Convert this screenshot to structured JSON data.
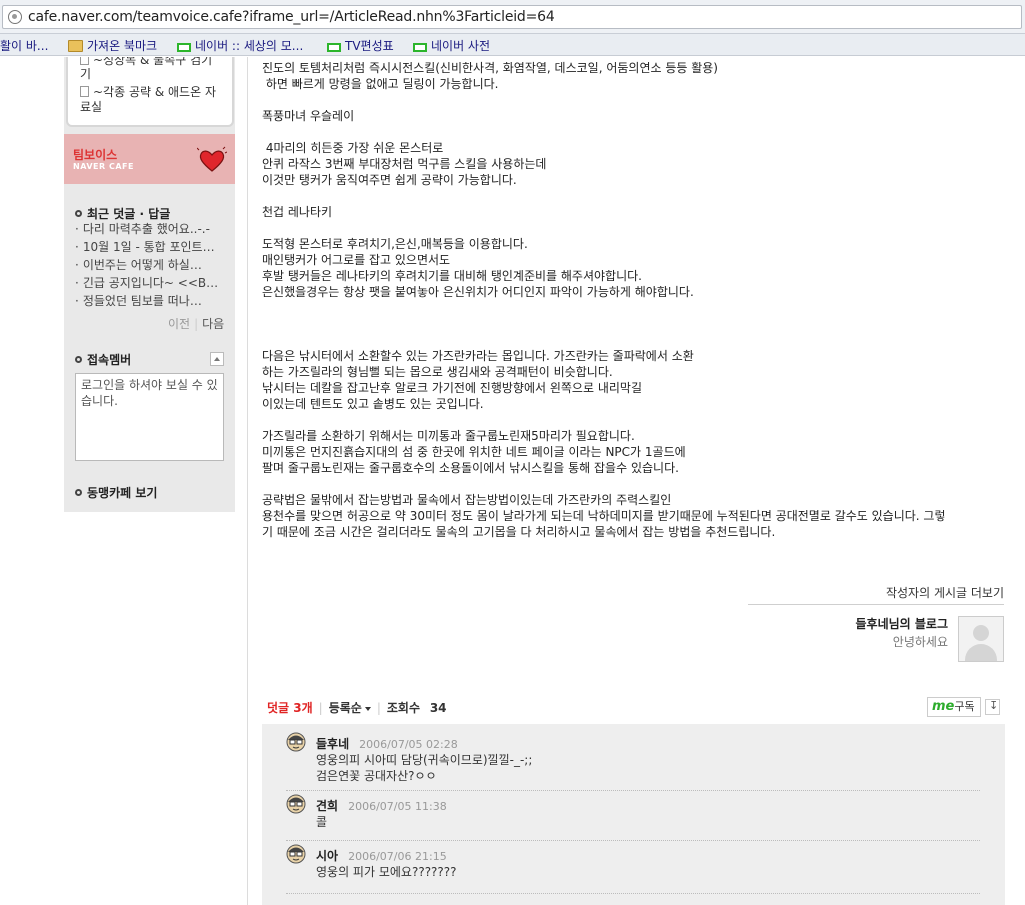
{
  "browser": {
    "url": "cafe.naver.com/teamvoice.cafe?iframe_url=/ArticleRead.nhn%3Farticleid=64",
    "bookmarks": [
      "활이 바...",
      "가져온 북마크",
      "네이버 :: 세상의 모...",
      "TV편성표",
      "네이버 사전"
    ]
  },
  "sidebar": {
    "menu_partial": "~성장목 & 물속구 검기",
    "menu_partial_2": "기",
    "menu_item": "~각종 공략 & 애드온 자",
    "menu_item_2": "료실",
    "banner_title": "팀보이스",
    "banner_sub": "NAVER CAFE",
    "recent_comments_title": "최근 덧글 · 답글",
    "recent_comments": [
      "다리 마력추출 했어요..-.-",
      "10월 1일 - 통합 포인트…",
      "이번주는 어떻게 하실…",
      "긴급 공지입니다~ <<B…",
      "정들었던 팀보를 떠나…"
    ],
    "prev": "이전",
    "next": "다음",
    "online_title": "접속멤버",
    "login_msg": "로그인을 하셔야 보실 수 있습니다.",
    "allied_title": "동맹카페 보기"
  },
  "article": {
    "lines": [
      "진도의 토템처리처럼 즉시시전스킬(신비한사격, 화염작열, 데스코일, 어둠의연소 등등 활용)",
      " 하면 빠르게 망령을 없애고 딜링이 가능합니다.",
      "",
      "폭풍마녀 우슬레이",
      "",
      " 4마리의 히든중 가장 쉬운 몬스터로",
      "안퀴 라작스 3번째 부대장처럼 먹구름 스킬을 사용하는데",
      "이것만 탱커가 움직여주면 쉽게 공략이 가능합니다.",
      "",
      "천겁 레나타키",
      "",
      "도적형 몬스터로 후려치기,은신,매복등을 이용합니다.",
      "매인탱커가 어그로를 잡고 있으면서도",
      "후발 탱커들은 레나타키의 후려치기를 대비해 탱인계준비를 해주셔야합니다.",
      "은신했을경우는 항상 팻을 붙여놓아 은신위치가 어디인지 파악이 가능하게 해야합니다.",
      "",
      "",
      "",
      "다음은 낚시터에서 소환할수 있는 가즈란카라는 몹입니다. 가즈란카는 줄파락에서 소환",
      "하는 가즈릴라의 형님뻘 되는 몹으로 생김새와 공격패턴이 비슷합니다.",
      "낚시터는 데칼을 잡고난후 알로크 가기전에 진행방향에서 왼쪽으로 내리막길",
      "이있는데 텐트도 있고 솥병도 있는 곳입니다.",
      "",
      "가즈릴라를 소환하기 위해서는 미끼통과 줄구룹노린재5마리가 필요합니다.",
      "미끼통은 먼지진흙습지대의 섬 중 한곳에 위치한 네트 페이글 이라는 NPC가 1골드에",
      "팔며 줄구룹노린재는 줄구룹호수의 소용돌이에서 낚시스킬을 통해 잡을수 있습니다.",
      "",
      "공략법은 물밖에서 잡는방법과 물속에서 잡는방법이있는데 가즈란카의 주력스킬인",
      "용천수를 맞으면 허공으로 약 30미터 정도 몸이 날라가게 되는데 낙하데미지를 받기때문에 누적된다면 공대전멸로 갈수도 있습니다. 그렇",
      "기 때문에 조금 시간은 걸리더라도 물속의 고기몹을 다 처리하시고 물속에서 잡는 방법을 추천드립니다."
    ]
  },
  "author": {
    "more_posts": "작성자의 게시글 더보기",
    "blog_title": "들후네님의 블로그",
    "blog_desc": "안녕하세요"
  },
  "comments_bar": {
    "count_label": "덧글 3개",
    "sort_label": "등록순",
    "views_label": "조회수",
    "views": "34",
    "me_label": "구독",
    "me_brand": "me"
  },
  "comments": [
    {
      "name": "들후네",
      "date": "2006/07/05 02:28",
      "body": "영웅의피 시아띠 담당(귀속이므로)낄낄-_-;;\n검은연꽃 공대자산?ㅇㅇ"
    },
    {
      "name": "견희",
      "date": "2006/07/05 11:38",
      "body": "콜"
    },
    {
      "name": "시아",
      "date": "2006/07/06 21:15",
      "body": "영웅의 피가 모에요???????"
    }
  ]
}
